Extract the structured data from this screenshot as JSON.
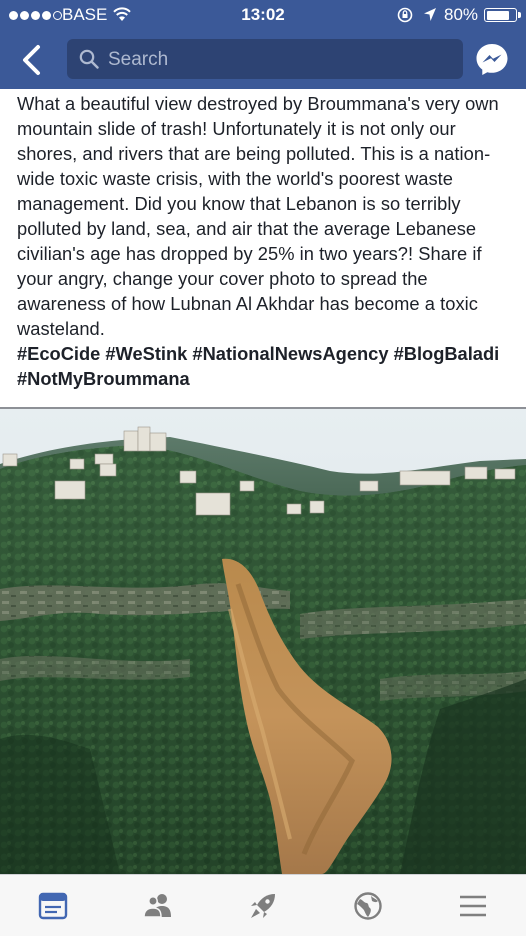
{
  "status_bar": {
    "carrier": "BASE",
    "time": "13:02",
    "battery_percent_label": "80%",
    "battery_level": 0.8,
    "signal_bars_filled": 4,
    "signal_bars_total": 5
  },
  "nav": {
    "search_placeholder": "Search",
    "back_icon": "chevron-left-icon",
    "messenger_icon": "messenger-icon"
  },
  "post": {
    "text": "What a beautiful view destroyed by Broummana's very own mountain slide of trash! Unfortunately it is not only our shores, and rivers that are being polluted. This is a nation-wide toxic waste crisis, with the world's poorest waste management. Did you know that Lebanon is so terribly polluted by land, sea, and air that the average Lebanese civilian's age has dropped by 25% in two years?! Share if your angry, change your cover photo to spread the awareness of how Lubnan Al Akhdar has become a toxic wasteland.",
    "hashtags": "#EcoCide #WeStink #NationalNewsAgency #BlogBaladi #NotMyBroummana"
  },
  "tabbar": {
    "tabs": [
      {
        "icon": "news-feed-icon",
        "active": true
      },
      {
        "icon": "friends-icon",
        "active": false
      },
      {
        "icon": "rocket-icon",
        "active": false
      },
      {
        "icon": "globe-icon",
        "active": false
      },
      {
        "icon": "menu-icon",
        "active": false
      }
    ]
  },
  "colors": {
    "brand_blue": "#3b5998",
    "search_field": "#2d4373",
    "active_tab": "#4267b2",
    "inactive_tab": "#7f7f7f"
  }
}
